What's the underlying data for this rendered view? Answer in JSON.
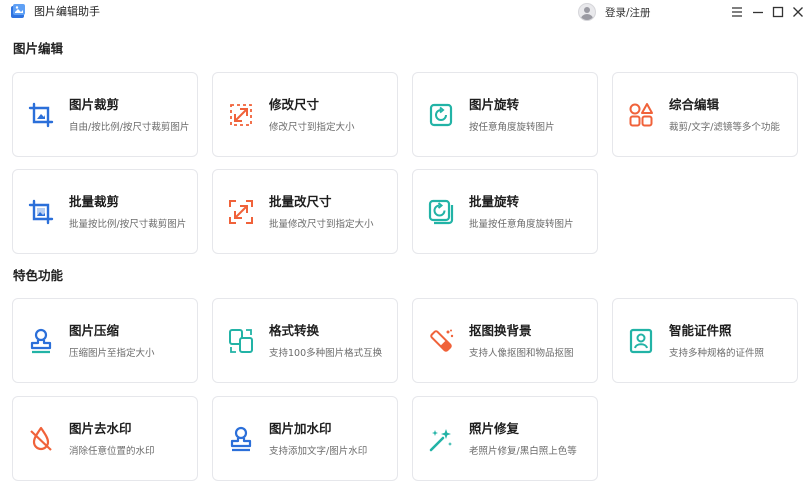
{
  "app": {
    "title": "图片编辑助手"
  },
  "header": {
    "login_label": "登录/注册"
  },
  "colors": {
    "blue": "#2b6fd9",
    "orange": "#f0623a",
    "teal": "#22b3a6",
    "card_border": "#e6e7eb"
  },
  "sections": [
    {
      "title": "图片编辑",
      "cards": [
        {
          "title": "图片裁剪",
          "desc": "自由/按比例/按尺寸裁剪图片",
          "icon": "crop-icon"
        },
        {
          "title": "修改尺寸",
          "desc": "修改尺寸到指定大小",
          "icon": "resize-icon"
        },
        {
          "title": "图片旋转",
          "desc": "按任意角度旋转图片",
          "icon": "rotate-icon"
        },
        {
          "title": "综合编辑",
          "desc": "裁剪/文字/滤镜等多个功能",
          "icon": "shapes-icon"
        },
        {
          "title": "批量裁剪",
          "desc": "批量按比例/按尺寸裁剪图片",
          "icon": "batch-crop-icon"
        },
        {
          "title": "批量改尺寸",
          "desc": "批量修改尺寸到指定大小",
          "icon": "batch-resize-icon"
        },
        {
          "title": "批量旋转",
          "desc": "批量按任意角度旋转图片",
          "icon": "batch-rotate-icon"
        }
      ]
    },
    {
      "title": "特色功能",
      "cards": [
        {
          "title": "图片压缩",
          "desc": "压缩图片至指定大小",
          "icon": "stamp-icon"
        },
        {
          "title": "格式转换",
          "desc": "支持100多种图片格式互换",
          "icon": "convert-icon"
        },
        {
          "title": "抠图换背景",
          "desc": "支持人像抠图和物品抠图",
          "icon": "eraser-icon"
        },
        {
          "title": "智能证件照",
          "desc": "支持多种规格的证件照",
          "icon": "id-photo-icon"
        },
        {
          "title": "图片去水印",
          "desc": "消除任意位置的水印",
          "icon": "remove-watermark-icon"
        },
        {
          "title": "图片加水印",
          "desc": "支持添加文字/图片水印",
          "icon": "add-watermark-icon"
        },
        {
          "title": "照片修复",
          "desc": "老照片修复/黑白照上色等",
          "icon": "magic-wand-icon"
        }
      ]
    }
  ]
}
